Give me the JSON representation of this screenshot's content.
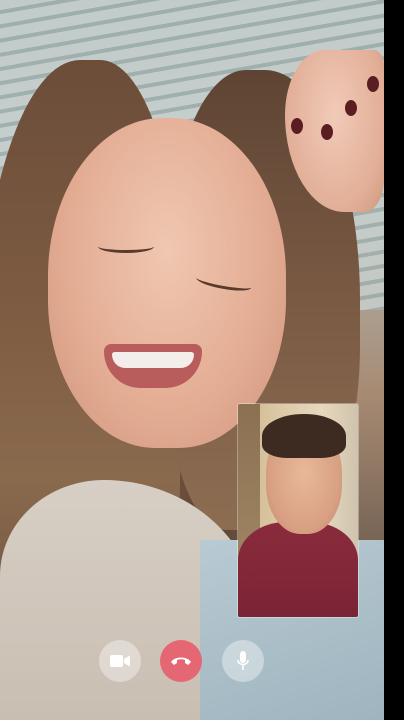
{
  "call": {
    "controls": [
      {
        "id": "video",
        "icon": "video-camera-icon"
      },
      {
        "id": "end",
        "icon": "hang-up-icon"
      },
      {
        "id": "mic",
        "icon": "microphone-icon"
      }
    ]
  },
  "colors": {
    "end_call": "#e85a6a",
    "control_bg": "rgba(255,255,255,0.38)",
    "icon": "#ffffff"
  }
}
